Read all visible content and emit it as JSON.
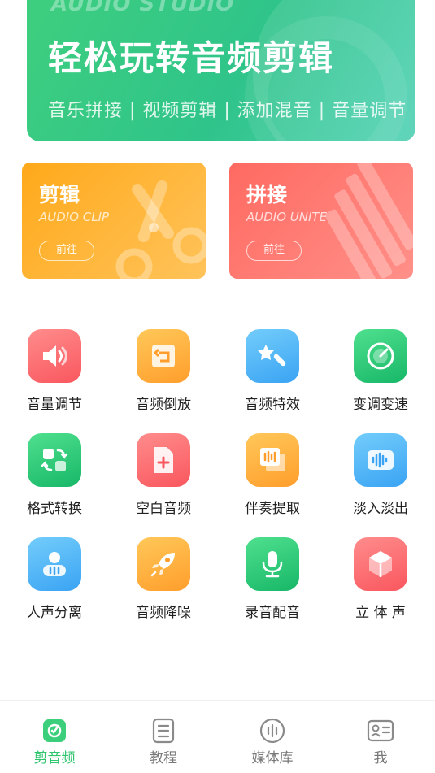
{
  "banner": {
    "brand": "AUDIO STUDIO",
    "title": "轻松玩转音频剪辑",
    "subtitle": "音乐拼接 | 视频剪辑 | 添加混音 | 音量调节"
  },
  "cards": [
    {
      "title": "剪辑",
      "subtitle": "AUDIO CLIP",
      "button": "前往",
      "icon": "scissors-icon"
    },
    {
      "title": "拼接",
      "subtitle": "AUDIO UNITE",
      "button": "前往",
      "icon": "stripes-icon"
    }
  ],
  "tools": [
    {
      "label": "音量调节",
      "icon": "volume-icon"
    },
    {
      "label": "音频倒放",
      "icon": "reverse-icon"
    },
    {
      "label": "音频特效",
      "icon": "magic-wand-icon"
    },
    {
      "label": "变调变速",
      "icon": "speedometer-icon"
    },
    {
      "label": "格式转换",
      "icon": "convert-icon"
    },
    {
      "label": "空白音频",
      "icon": "blank-file-icon"
    },
    {
      "label": "伴奏提取",
      "icon": "extract-icon"
    },
    {
      "label": "淡入淡出",
      "icon": "fade-icon"
    },
    {
      "label": "人声分离",
      "icon": "voice-separate-icon"
    },
    {
      "label": "音频降噪",
      "icon": "rocket-icon"
    },
    {
      "label": "录音配音",
      "icon": "microphone-icon"
    },
    {
      "label": "立 体 声",
      "icon": "cube-icon"
    }
  ],
  "tabbar": {
    "items": [
      {
        "label": "剪音频",
        "icon": "clip-tab-icon",
        "active": true
      },
      {
        "label": "教程",
        "icon": "tutorial-tab-icon",
        "active": false
      },
      {
        "label": "媒体库",
        "icon": "media-library-tab-icon",
        "active": false
      },
      {
        "label": "我",
        "icon": "profile-tab-icon",
        "active": false
      }
    ]
  },
  "colors": {
    "accent": "#2fc46e",
    "clip_card": "#ffa91a",
    "unite_card": "#ff6a61"
  }
}
